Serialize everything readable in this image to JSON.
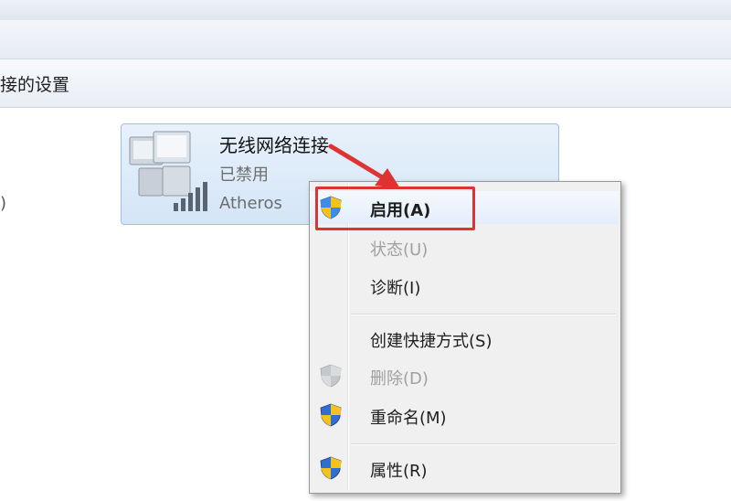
{
  "toolbar": {
    "settings_label": "接的设置"
  },
  "left_fragment": ")",
  "connection": {
    "name": "无线网络连接",
    "status": "已禁用",
    "device": "Atheros"
  },
  "context_menu": {
    "items": [
      {
        "label": "启用(A)",
        "enabled": true,
        "bold": true,
        "shield": true
      },
      {
        "label": "状态(U)",
        "enabled": false,
        "bold": false,
        "shield": false
      },
      {
        "label": "诊断(I)",
        "enabled": true,
        "bold": false,
        "shield": false
      },
      {
        "label": "创建快捷方式(S)",
        "enabled": true,
        "bold": false,
        "shield": false
      },
      {
        "label": "删除(D)",
        "enabled": false,
        "bold": false,
        "shield": true
      },
      {
        "label": "重命名(M)",
        "enabled": true,
        "bold": false,
        "shield": true
      },
      {
        "label": "属性(R)",
        "enabled": true,
        "bold": false,
        "shield": true
      }
    ]
  },
  "colors": {
    "highlight": "#dd3333",
    "tile_bg": "#d4e5f7",
    "menu_bg": "#f0f0f0"
  },
  "icons": [
    "network-adapter-icon",
    "signal-bars-icon",
    "uac-shield-icon"
  ]
}
